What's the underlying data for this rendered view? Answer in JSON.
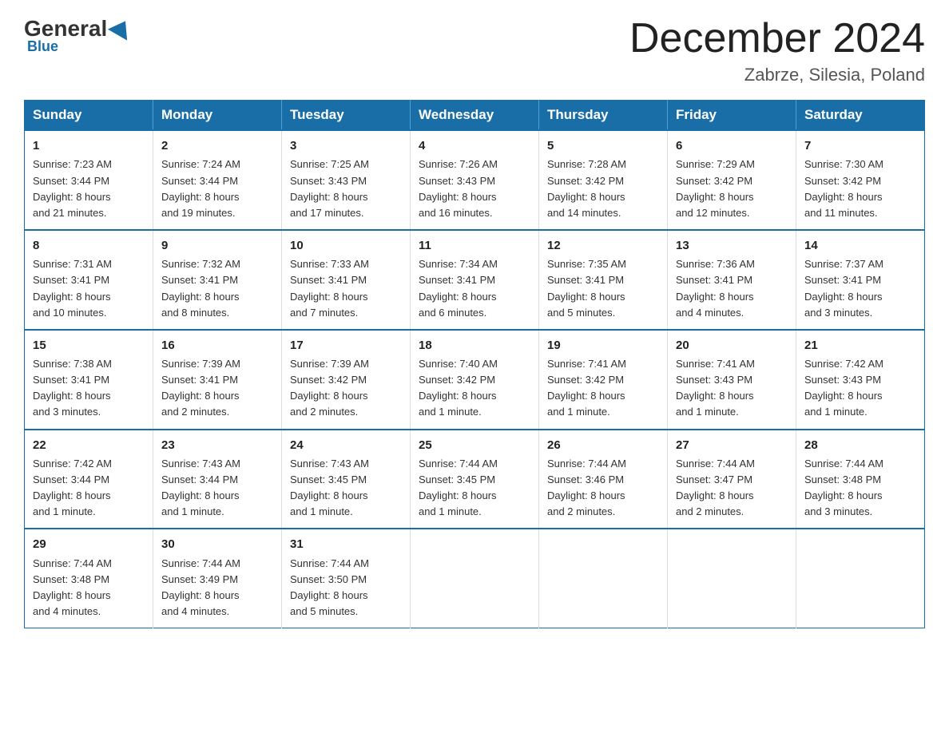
{
  "header": {
    "logo_general": "General",
    "logo_blue": "Blue",
    "month_title": "December 2024",
    "location": "Zabrze, Silesia, Poland"
  },
  "days_of_week": [
    "Sunday",
    "Monday",
    "Tuesday",
    "Wednesday",
    "Thursday",
    "Friday",
    "Saturday"
  ],
  "weeks": [
    [
      {
        "day": "1",
        "sunrise": "7:23 AM",
        "sunset": "3:44 PM",
        "daylight": "8 hours and 21 minutes."
      },
      {
        "day": "2",
        "sunrise": "7:24 AM",
        "sunset": "3:44 PM",
        "daylight": "8 hours and 19 minutes."
      },
      {
        "day": "3",
        "sunrise": "7:25 AM",
        "sunset": "3:43 PM",
        "daylight": "8 hours and 17 minutes."
      },
      {
        "day": "4",
        "sunrise": "7:26 AM",
        "sunset": "3:43 PM",
        "daylight": "8 hours and 16 minutes."
      },
      {
        "day": "5",
        "sunrise": "7:28 AM",
        "sunset": "3:42 PM",
        "daylight": "8 hours and 14 minutes."
      },
      {
        "day": "6",
        "sunrise": "7:29 AM",
        "sunset": "3:42 PM",
        "daylight": "8 hours and 12 minutes."
      },
      {
        "day": "7",
        "sunrise": "7:30 AM",
        "sunset": "3:42 PM",
        "daylight": "8 hours and 11 minutes."
      }
    ],
    [
      {
        "day": "8",
        "sunrise": "7:31 AM",
        "sunset": "3:41 PM",
        "daylight": "8 hours and 10 minutes."
      },
      {
        "day": "9",
        "sunrise": "7:32 AM",
        "sunset": "3:41 PM",
        "daylight": "8 hours and 8 minutes."
      },
      {
        "day": "10",
        "sunrise": "7:33 AM",
        "sunset": "3:41 PM",
        "daylight": "8 hours and 7 minutes."
      },
      {
        "day": "11",
        "sunrise": "7:34 AM",
        "sunset": "3:41 PM",
        "daylight": "8 hours and 6 minutes."
      },
      {
        "day": "12",
        "sunrise": "7:35 AM",
        "sunset": "3:41 PM",
        "daylight": "8 hours and 5 minutes."
      },
      {
        "day": "13",
        "sunrise": "7:36 AM",
        "sunset": "3:41 PM",
        "daylight": "8 hours and 4 minutes."
      },
      {
        "day": "14",
        "sunrise": "7:37 AM",
        "sunset": "3:41 PM",
        "daylight": "8 hours and 3 minutes."
      }
    ],
    [
      {
        "day": "15",
        "sunrise": "7:38 AM",
        "sunset": "3:41 PM",
        "daylight": "8 hours and 3 minutes."
      },
      {
        "day": "16",
        "sunrise": "7:39 AM",
        "sunset": "3:41 PM",
        "daylight": "8 hours and 2 minutes."
      },
      {
        "day": "17",
        "sunrise": "7:39 AM",
        "sunset": "3:42 PM",
        "daylight": "8 hours and 2 minutes."
      },
      {
        "day": "18",
        "sunrise": "7:40 AM",
        "sunset": "3:42 PM",
        "daylight": "8 hours and 1 minute."
      },
      {
        "day": "19",
        "sunrise": "7:41 AM",
        "sunset": "3:42 PM",
        "daylight": "8 hours and 1 minute."
      },
      {
        "day": "20",
        "sunrise": "7:41 AM",
        "sunset": "3:43 PM",
        "daylight": "8 hours and 1 minute."
      },
      {
        "day": "21",
        "sunrise": "7:42 AM",
        "sunset": "3:43 PM",
        "daylight": "8 hours and 1 minute."
      }
    ],
    [
      {
        "day": "22",
        "sunrise": "7:42 AM",
        "sunset": "3:44 PM",
        "daylight": "8 hours and 1 minute."
      },
      {
        "day": "23",
        "sunrise": "7:43 AM",
        "sunset": "3:44 PM",
        "daylight": "8 hours and 1 minute."
      },
      {
        "day": "24",
        "sunrise": "7:43 AM",
        "sunset": "3:45 PM",
        "daylight": "8 hours and 1 minute."
      },
      {
        "day": "25",
        "sunrise": "7:44 AM",
        "sunset": "3:45 PM",
        "daylight": "8 hours and 1 minute."
      },
      {
        "day": "26",
        "sunrise": "7:44 AM",
        "sunset": "3:46 PM",
        "daylight": "8 hours and 2 minutes."
      },
      {
        "day": "27",
        "sunrise": "7:44 AM",
        "sunset": "3:47 PM",
        "daylight": "8 hours and 2 minutes."
      },
      {
        "day": "28",
        "sunrise": "7:44 AM",
        "sunset": "3:48 PM",
        "daylight": "8 hours and 3 minutes."
      }
    ],
    [
      {
        "day": "29",
        "sunrise": "7:44 AM",
        "sunset": "3:48 PM",
        "daylight": "8 hours and 4 minutes."
      },
      {
        "day": "30",
        "sunrise": "7:44 AM",
        "sunset": "3:49 PM",
        "daylight": "8 hours and 4 minutes."
      },
      {
        "day": "31",
        "sunrise": "7:44 AM",
        "sunset": "3:50 PM",
        "daylight": "8 hours and 5 minutes."
      },
      null,
      null,
      null,
      null
    ]
  ],
  "labels": {
    "sunrise": "Sunrise:",
    "sunset": "Sunset:",
    "daylight": "Daylight:"
  }
}
